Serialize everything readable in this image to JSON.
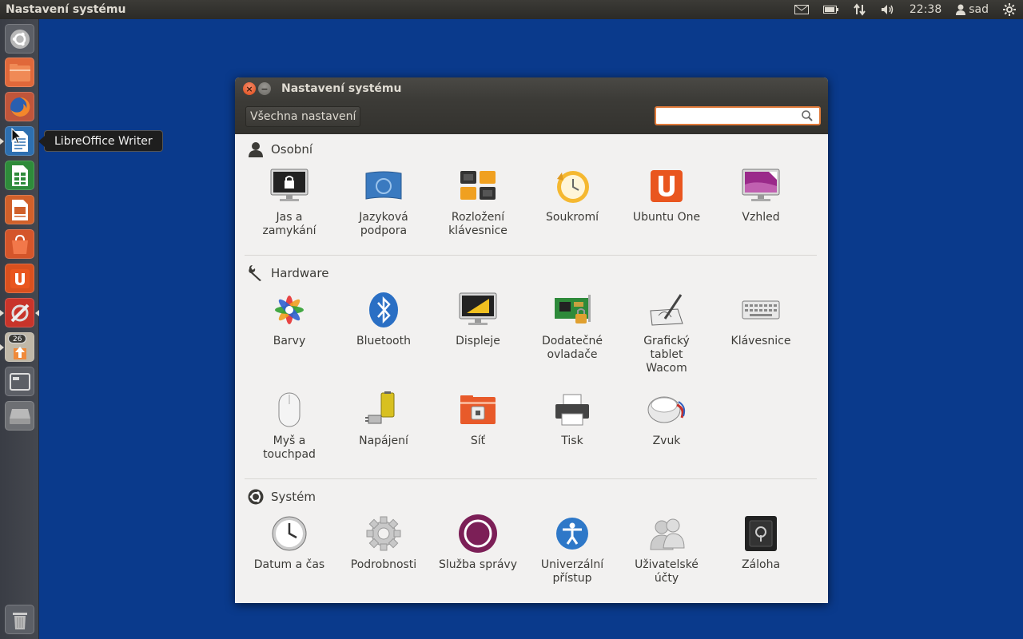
{
  "top_panel": {
    "app_title": "Nastavení systému",
    "clock": "22:38",
    "user": "sad"
  },
  "launcher": {
    "tooltip": "LibreOffice Writer",
    "update_badge": "26"
  },
  "window": {
    "title": "Nastavení systému",
    "all_settings_label": "Všechna nastavení",
    "search_value": ""
  },
  "sections": {
    "personal": {
      "title": "Osobní",
      "items": [
        {
          "label": "Jas a\nzamykání"
        },
        {
          "label": "Jazyková\npodpora"
        },
        {
          "label": "Rozložení\nklávesnice"
        },
        {
          "label": "Soukromí"
        },
        {
          "label": "Ubuntu One"
        },
        {
          "label": "Vzhled"
        }
      ]
    },
    "hardware": {
      "title": "Hardware",
      "items": [
        {
          "label": "Barvy"
        },
        {
          "label": "Bluetooth"
        },
        {
          "label": "Displeje"
        },
        {
          "label": "Dodatečné\novladače"
        },
        {
          "label": "Grafický\ntablet\nWacom"
        },
        {
          "label": "Klávesnice"
        },
        {
          "label": "Myš a\ntouchpad"
        },
        {
          "label": "Napájení"
        },
        {
          "label": "Síť"
        },
        {
          "label": "Tisk"
        },
        {
          "label": "Zvuk"
        }
      ]
    },
    "system": {
      "title": "Systém",
      "items": [
        {
          "label": "Datum a čas"
        },
        {
          "label": "Podrobnosti"
        },
        {
          "label": "Služba správy"
        },
        {
          "label": "Univerzální\npřístup"
        },
        {
          "label": "Uživatelské\núčty"
        },
        {
          "label": "Záloha"
        }
      ]
    }
  }
}
